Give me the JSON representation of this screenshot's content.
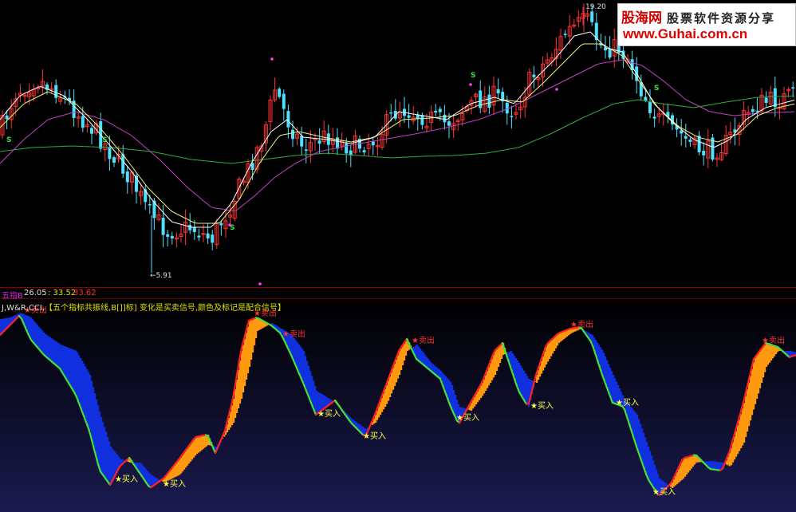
{
  "watermark": {
    "line1_brand": "股海网",
    "line1_slogan": "股票软件资源分享",
    "line2": "www.Guhai.com.cn"
  },
  "indicator": {
    "name": "五指B",
    "value1": "26.05",
    "value2": ": 33.52",
    "value3": "33.62",
    "formula_prefix": "J,W&R,CCI,",
    "formula_text": "【五个指标共振线,B[]]标] 变化是买卖信号,颜色及标记是配合信号】"
  },
  "signals": {
    "sell_label": "★卖出",
    "buy_label": "★买入",
    "sell_points": [
      [
        30,
        392
      ],
      [
        318,
        396
      ],
      [
        354,
        422
      ],
      [
        516,
        430
      ],
      [
        715,
        410
      ],
      [
        955,
        430
      ]
    ],
    "buy_points": [
      [
        144,
        604
      ],
      [
        204,
        610
      ],
      [
        398,
        522
      ],
      [
        455,
        550
      ],
      [
        572,
        527
      ],
      [
        665,
        512
      ],
      [
        772,
        508
      ],
      [
        818,
        620
      ]
    ]
  },
  "price_labels": {
    "high": "19.20",
    "low": "5.91",
    "high_prefix": "←",
    "low_prefix": "←"
  },
  "s_markers": [
    "S",
    "S",
    "S",
    "S",
    "S"
  ],
  "chart_data": [
    {
      "type": "candlestick",
      "title": "",
      "price_range": [
        5.91,
        19.2
      ],
      "annotations": [
        "19.20",
        "5.91"
      ],
      "grid": false
    },
    {
      "type": "area",
      "title": "",
      "series": [],
      "annotations": [
        "卖出",
        "买入"
      ],
      "grid": false
    }
  ],
  "colors": {
    "up": "#ff3333",
    "down": "#4de0ff",
    "ma_fast": "#ffffff",
    "ma_mid": "#f0f080",
    "ma_slow": "#c040c0",
    "ma_long": "#30b040",
    "osc_line_up": "#ff2020",
    "osc_line_dn": "#40e040",
    "fill_orange": "#ff9a10",
    "fill_blue": "#1030e0",
    "signal_star": "#ffff40",
    "sell_star": "#ff3030"
  }
}
